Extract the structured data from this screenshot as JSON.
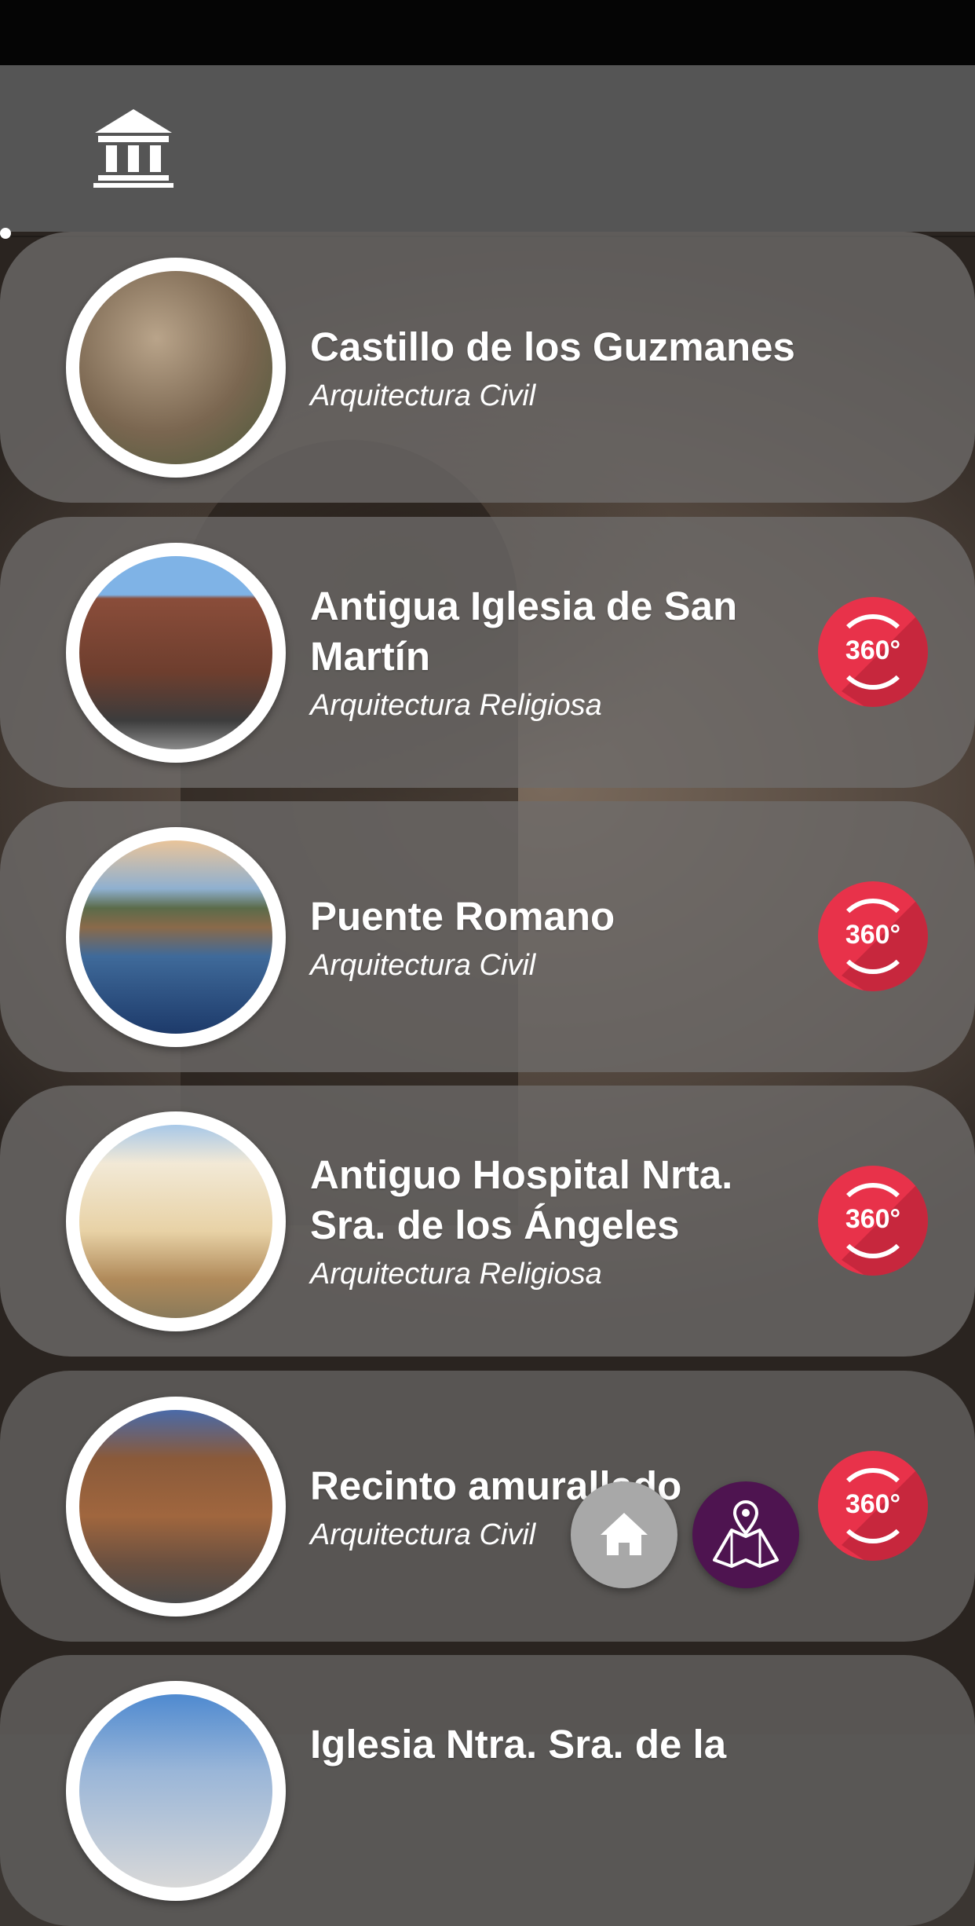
{
  "header": {
    "logo_icon": "museum-icon"
  },
  "items": [
    {
      "title": "Castillo  de los Guzmanes",
      "category": "Arquitectura Civil",
      "has360": false,
      "badge": ""
    },
    {
      "title": "Antigua Iglesia de San Martín",
      "category": "Arquitectura Religiosa",
      "has360": true,
      "badge": "360°"
    },
    {
      "title": "Puente Romano",
      "category": "Arquitectura Civil",
      "has360": true,
      "badge": "360°"
    },
    {
      "title": "Antiguo Hospital Nrta. Sra. de los Ángeles",
      "category": "Arquitectura Religiosa",
      "has360": true,
      "badge": "360°"
    },
    {
      "title": "Recinto amurallado",
      "category": "Arquitectura Civil",
      "has360": true,
      "badge": "360°"
    },
    {
      "title": "Iglesia Ntra. Sra. de la",
      "category": "",
      "has360": false,
      "badge": ""
    }
  ],
  "fab": {
    "home_icon": "home-icon",
    "map_icon": "map-pin-icon"
  },
  "colors": {
    "appbar": "#555555",
    "badge": "#e8324a",
    "map_button": "#4e1450",
    "home_button": "#a8a8a8"
  }
}
